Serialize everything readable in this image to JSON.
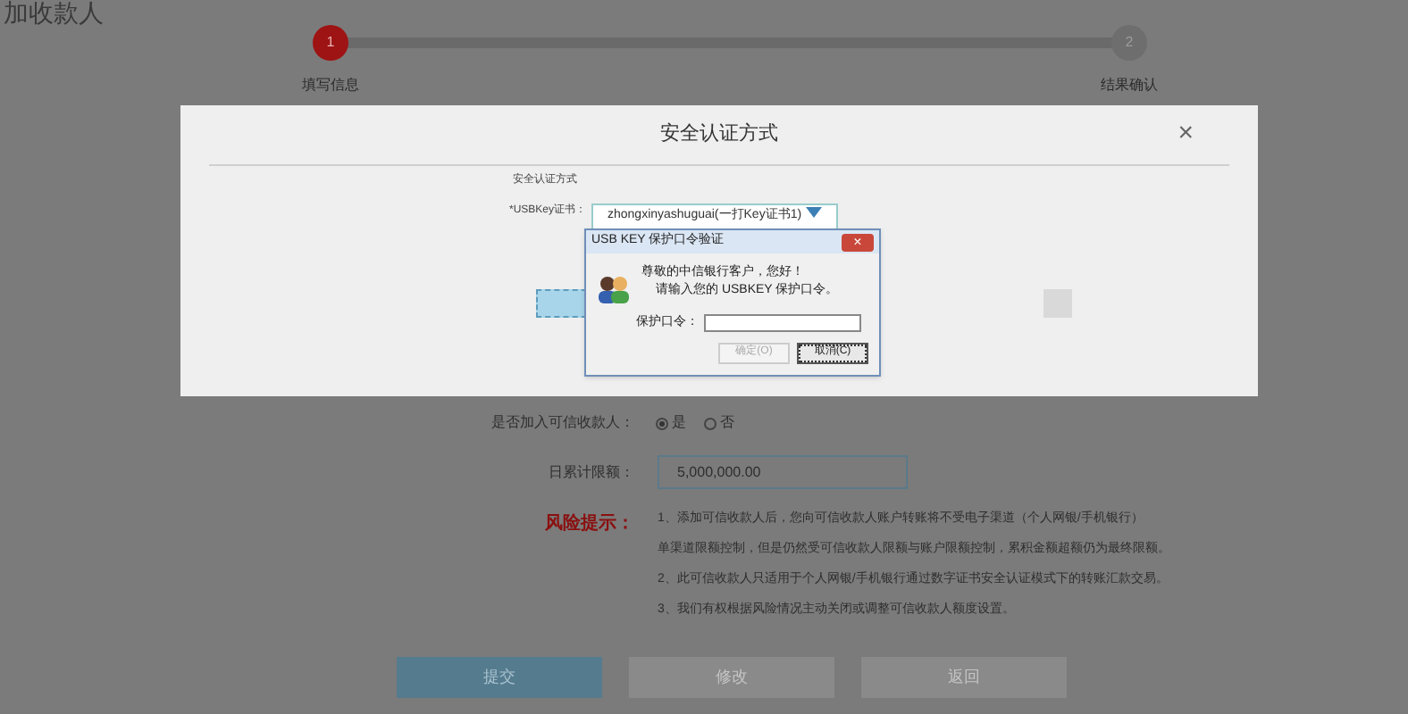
{
  "page_title": "加收款人",
  "steps": [
    {
      "number": "1",
      "label": "填写信息",
      "selected": true
    },
    {
      "number": "2",
      "label": "结果确认",
      "selected": false
    }
  ],
  "form": {
    "trusted_payee": {
      "label": "是否加入可信收款人：",
      "options": [
        {
          "label": "是",
          "selected": true
        },
        {
          "label": "否",
          "selected": false
        }
      ]
    },
    "daily_limit": {
      "label": "日累计限额：",
      "value": "5,000,000.00"
    },
    "risk": {
      "label": "风险提示：",
      "lines": [
        "1、添加可信收款人后，您向可信收款人账户转账将不受电子渠道（个人网银/手机银行）",
        "单渠道限额控制，但是仍然受可信收款人限额与账户限额控制，累积金额超额仍为最终限额。",
        "2、此可信收款人只适用于个人网银/手机银行通过数字证书安全认证模式下的转账汇款交易。",
        "3、我们有权根据风险情况主动关闭或调整可信收款人额度设置。"
      ]
    },
    "buttons": [
      {
        "label": "提交",
        "kind": "primary"
      },
      {
        "label": "修改",
        "kind": "secondary"
      },
      {
        "label": "返回",
        "kind": "secondary"
      }
    ]
  },
  "modal": {
    "title": "安全认证方式",
    "close": "×",
    "section_label": "安全认证方式",
    "cert_label": "*USBKey证书：",
    "cert_value": "zhongxinyashuguai(一打Key证书1)"
  },
  "dialog": {
    "title": "USB KEY 保护口令验证",
    "close": "×",
    "greeting": "尊敬的中信银行客户，您好！",
    "prompt": "请输入您的 USBKEY 保护口令。",
    "password_label": "保护口令：",
    "buttons": [
      {
        "label": "确定(O)",
        "disabled": true
      },
      {
        "label": "取消(C)",
        "disabled": false
      }
    ]
  }
}
